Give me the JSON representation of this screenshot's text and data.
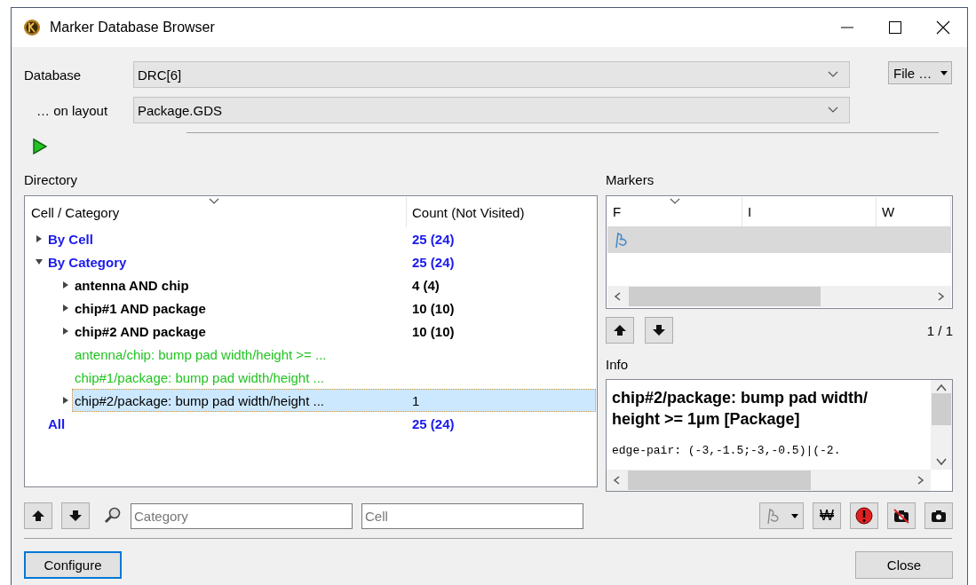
{
  "window": {
    "title": "Marker Database Browser"
  },
  "database": {
    "label": "Database",
    "value": "DRC[6]"
  },
  "layout": {
    "label": "… on layout",
    "value": "Package.GDS"
  },
  "file_button": {
    "label": "File …"
  },
  "directory": {
    "label": "Directory",
    "columns": [
      "Cell / Category",
      "Count (Not Visited)"
    ],
    "tree": [
      {
        "label": "By Cell",
        "count": "25 (24)",
        "kind": "group",
        "leaf": false,
        "expanded": false,
        "selected": false
      },
      {
        "label": "By Category",
        "count": "25 (24)",
        "kind": "group",
        "leaf": false,
        "expanded": true,
        "selected": false,
        "children": [
          {
            "label": "antenna AND chip",
            "count": "4 (4)",
            "kind": "category",
            "leaf": false,
            "expanded": false,
            "selected": false
          },
          {
            "label": "chip#1 AND package",
            "count": "10 (10)",
            "kind": "category",
            "leaf": false,
            "expanded": false,
            "selected": false
          },
          {
            "label": "chip#2 AND package",
            "count": "10 (10)",
            "kind": "category",
            "leaf": false,
            "expanded": false,
            "selected": false
          },
          {
            "label": "antenna/chip: bump pad width/height >= ...",
            "kind": "visited",
            "leaf": true,
            "selected": false
          },
          {
            "label": "chip#1/package: bump pad width/height ...",
            "kind": "visited",
            "leaf": true,
            "selected": false
          },
          {
            "label": "chip#2/package: bump pad width/height ...",
            "count": "1",
            "kind": "item",
            "leaf": false,
            "expanded": false,
            "selected": true
          }
        ]
      },
      {
        "label": "All",
        "count": "25 (24)",
        "kind": "group",
        "leaf": true,
        "selected": false
      }
    ]
  },
  "markers": {
    "label": "Markers",
    "columns": [
      "F",
      "I",
      "W"
    ],
    "rows": [
      {
        "selected": true
      }
    ],
    "position": "1 / 1"
  },
  "info": {
    "label": "Info",
    "title": "chip#2/package: bump pad width/ height >= 1µm [Package]",
    "detail": "edge-pair: (-3,-1.5;-3,-0.5)|(-2."
  },
  "filters": {
    "category_placeholder": "Category",
    "cell_placeholder": "Cell"
  },
  "waive_button": {
    "label": "₩"
  },
  "buttons": {
    "configure": "Configure",
    "close": "Close"
  }
}
